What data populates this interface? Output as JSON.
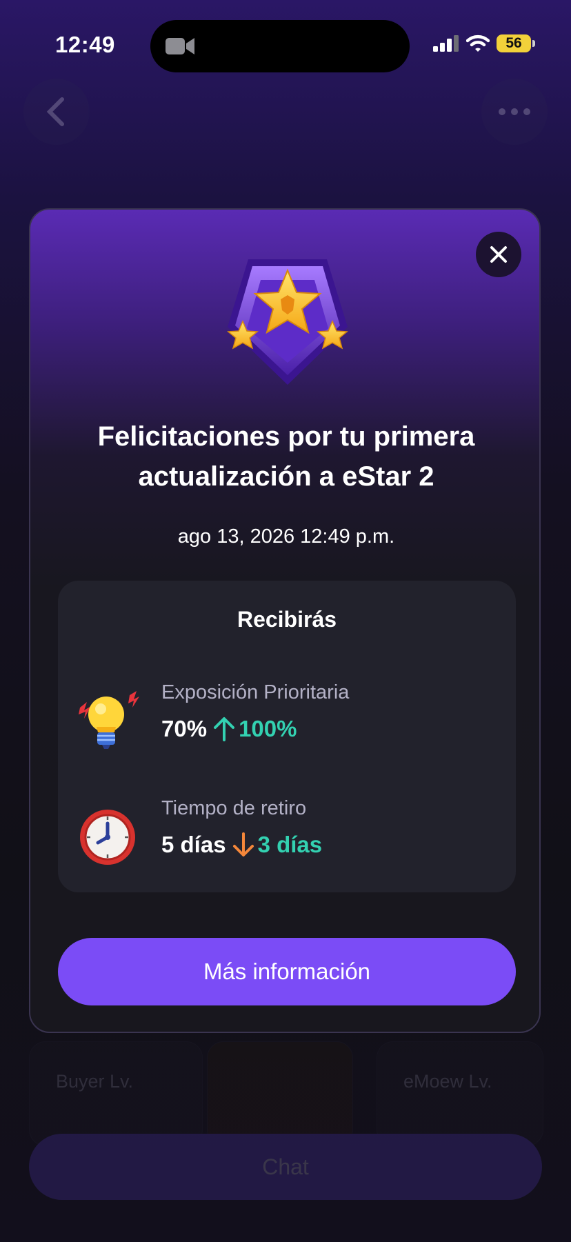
{
  "status_bar": {
    "time": "12:49",
    "battery": "56"
  },
  "background": {
    "buyer_label": "Buyer Lv.",
    "emoew_label": "eMoew Lv.",
    "chat_label": "Chat"
  },
  "modal": {
    "title": "Felicitaciones por tu primera actualización a eStar 2",
    "date": "ago 13, 2026 12:49 p.m.",
    "benefits_title": "Recibirás",
    "benefits": [
      {
        "icon": "lightbulb-icon",
        "label": "Exposición Prioritaria",
        "old_value": "70%",
        "direction": "up",
        "new_value": "100%"
      },
      {
        "icon": "clock-icon",
        "label": "Tiempo de retiro",
        "old_value": "5 días",
        "direction": "down",
        "new_value": "3 días"
      }
    ],
    "button_label": "Más información"
  },
  "colors": {
    "accent": "#7b4cf6",
    "positive": "#33d1b1",
    "down_arrow": "#f5873a",
    "up_arrow": "#33d1b1"
  }
}
